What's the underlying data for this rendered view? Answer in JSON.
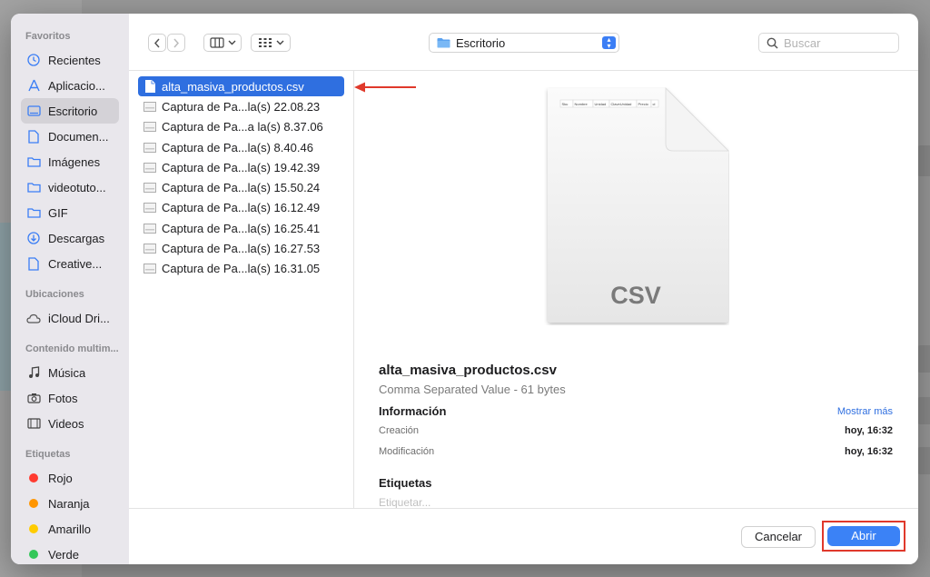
{
  "sidebar": {
    "sections": [
      {
        "title": "Favoritos",
        "items": [
          {
            "label": "Recientes",
            "icon": "clock-icon"
          },
          {
            "label": "Aplicacio...",
            "icon": "apps-icon"
          },
          {
            "label": "Escritorio",
            "icon": "desktop-icon",
            "selected": true
          },
          {
            "label": "Documen...",
            "icon": "document-icon"
          },
          {
            "label": "Imágenes",
            "icon": "folder-icon"
          },
          {
            "label": "videotuto...",
            "icon": "folder-icon"
          },
          {
            "label": "GIF",
            "icon": "folder-icon"
          },
          {
            "label": "Descargas",
            "icon": "download-icon"
          },
          {
            "label": "Creative...",
            "icon": "file-icon"
          }
        ]
      },
      {
        "title": "Ubicaciones",
        "items": [
          {
            "label": "iCloud Dri...",
            "icon": "cloud-icon"
          }
        ]
      },
      {
        "title": "Contenido multim...",
        "items": [
          {
            "label": "Música",
            "icon": "music-icon"
          },
          {
            "label": "Fotos",
            "icon": "camera-icon"
          },
          {
            "label": "Videos",
            "icon": "film-icon"
          }
        ]
      },
      {
        "title": "Etiquetas",
        "items": [
          {
            "label": "Rojo",
            "color": "#ff3b30"
          },
          {
            "label": "Naranja",
            "color": "#ff9500"
          },
          {
            "label": "Amarillo",
            "color": "#ffcc00"
          },
          {
            "label": "Verde",
            "color": "#34c759"
          }
        ]
      }
    ]
  },
  "toolbar": {
    "location": "Escritorio",
    "search_placeholder": "Buscar"
  },
  "files": [
    {
      "name": "alta_masiva_productos.csv",
      "selected": true
    },
    {
      "name": "Captura de Pa...la(s) 22.08.23"
    },
    {
      "name": "Captura de Pa...a la(s) 8.37.06"
    },
    {
      "name": "Captura de Pa...la(s) 8.40.46"
    },
    {
      "name": "Captura de Pa...la(s) 19.42.39"
    },
    {
      "name": "Captura de Pa...la(s) 15.50.24"
    },
    {
      "name": "Captura de Pa...la(s) 16.12.49"
    },
    {
      "name": "Captura de Pa...la(s) 16.25.41"
    },
    {
      "name": "Captura de Pa...la(s) 16.27.53"
    },
    {
      "name": "Captura de Pa...la(s) 16.31.05"
    }
  ],
  "preview": {
    "thumb_headers": [
      "Sku",
      "Nombre",
      "Unidad",
      "ClaveUnidad",
      "Precio",
      "cl"
    ],
    "thumb_ext": "CSV",
    "file_name": "alta_masiva_productos.csv",
    "kind": "Comma Separated Value - 61 bytes",
    "info_title": "Información",
    "more_label": "Mostrar más",
    "created_label": "Creación",
    "created_value": "hoy, 16:32",
    "modified_label": "Modificación",
    "modified_value": "hoy, 16:32",
    "tags_title": "Etiquetas",
    "tags_placeholder": "Etiquetar..."
  },
  "footer": {
    "cancel_label": "Cancelar",
    "open_label": "Abrir"
  },
  "colors": {
    "accent": "#3b7ef5",
    "selection": "#2f6fe0",
    "annotation": "#e0392b"
  }
}
